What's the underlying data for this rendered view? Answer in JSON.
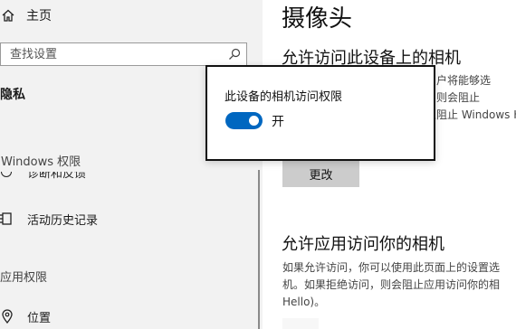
{
  "sidebar": {
    "home_label": "主页",
    "search_placeholder": "查找设置",
    "privacy_title": "隐私",
    "windows_permissions_header": "Windows 权限",
    "clipped_item_label": "诊断和反馈",
    "activity_history_label": "活动历史记录",
    "app_permissions_header": "应用权限",
    "location_label": "位置"
  },
  "main": {
    "page_title": "摄像头",
    "section1_title": "允许访问此设备上的相机",
    "section1_desc": [
      "用户将能够选",
      "，则会阻止",
      "且阻止 Windows H"
    ],
    "change_button": "更改",
    "section2_title": "允许应用访问你的相机",
    "section2_desc": [
      "如果允许访问，你可以使用此页面上的设置选",
      "机。如果拒绝访问，则会阻止应用访问你的相",
      "Hello)。"
    ]
  },
  "popup": {
    "title": "此设备的相机访问权限",
    "toggle_state": "开",
    "toggle_on": true,
    "accent_color": "#0067c0"
  },
  "icons": {
    "home": "home-icon",
    "search": "search-icon",
    "activity": "activity-history-icon",
    "location": "location-icon"
  }
}
